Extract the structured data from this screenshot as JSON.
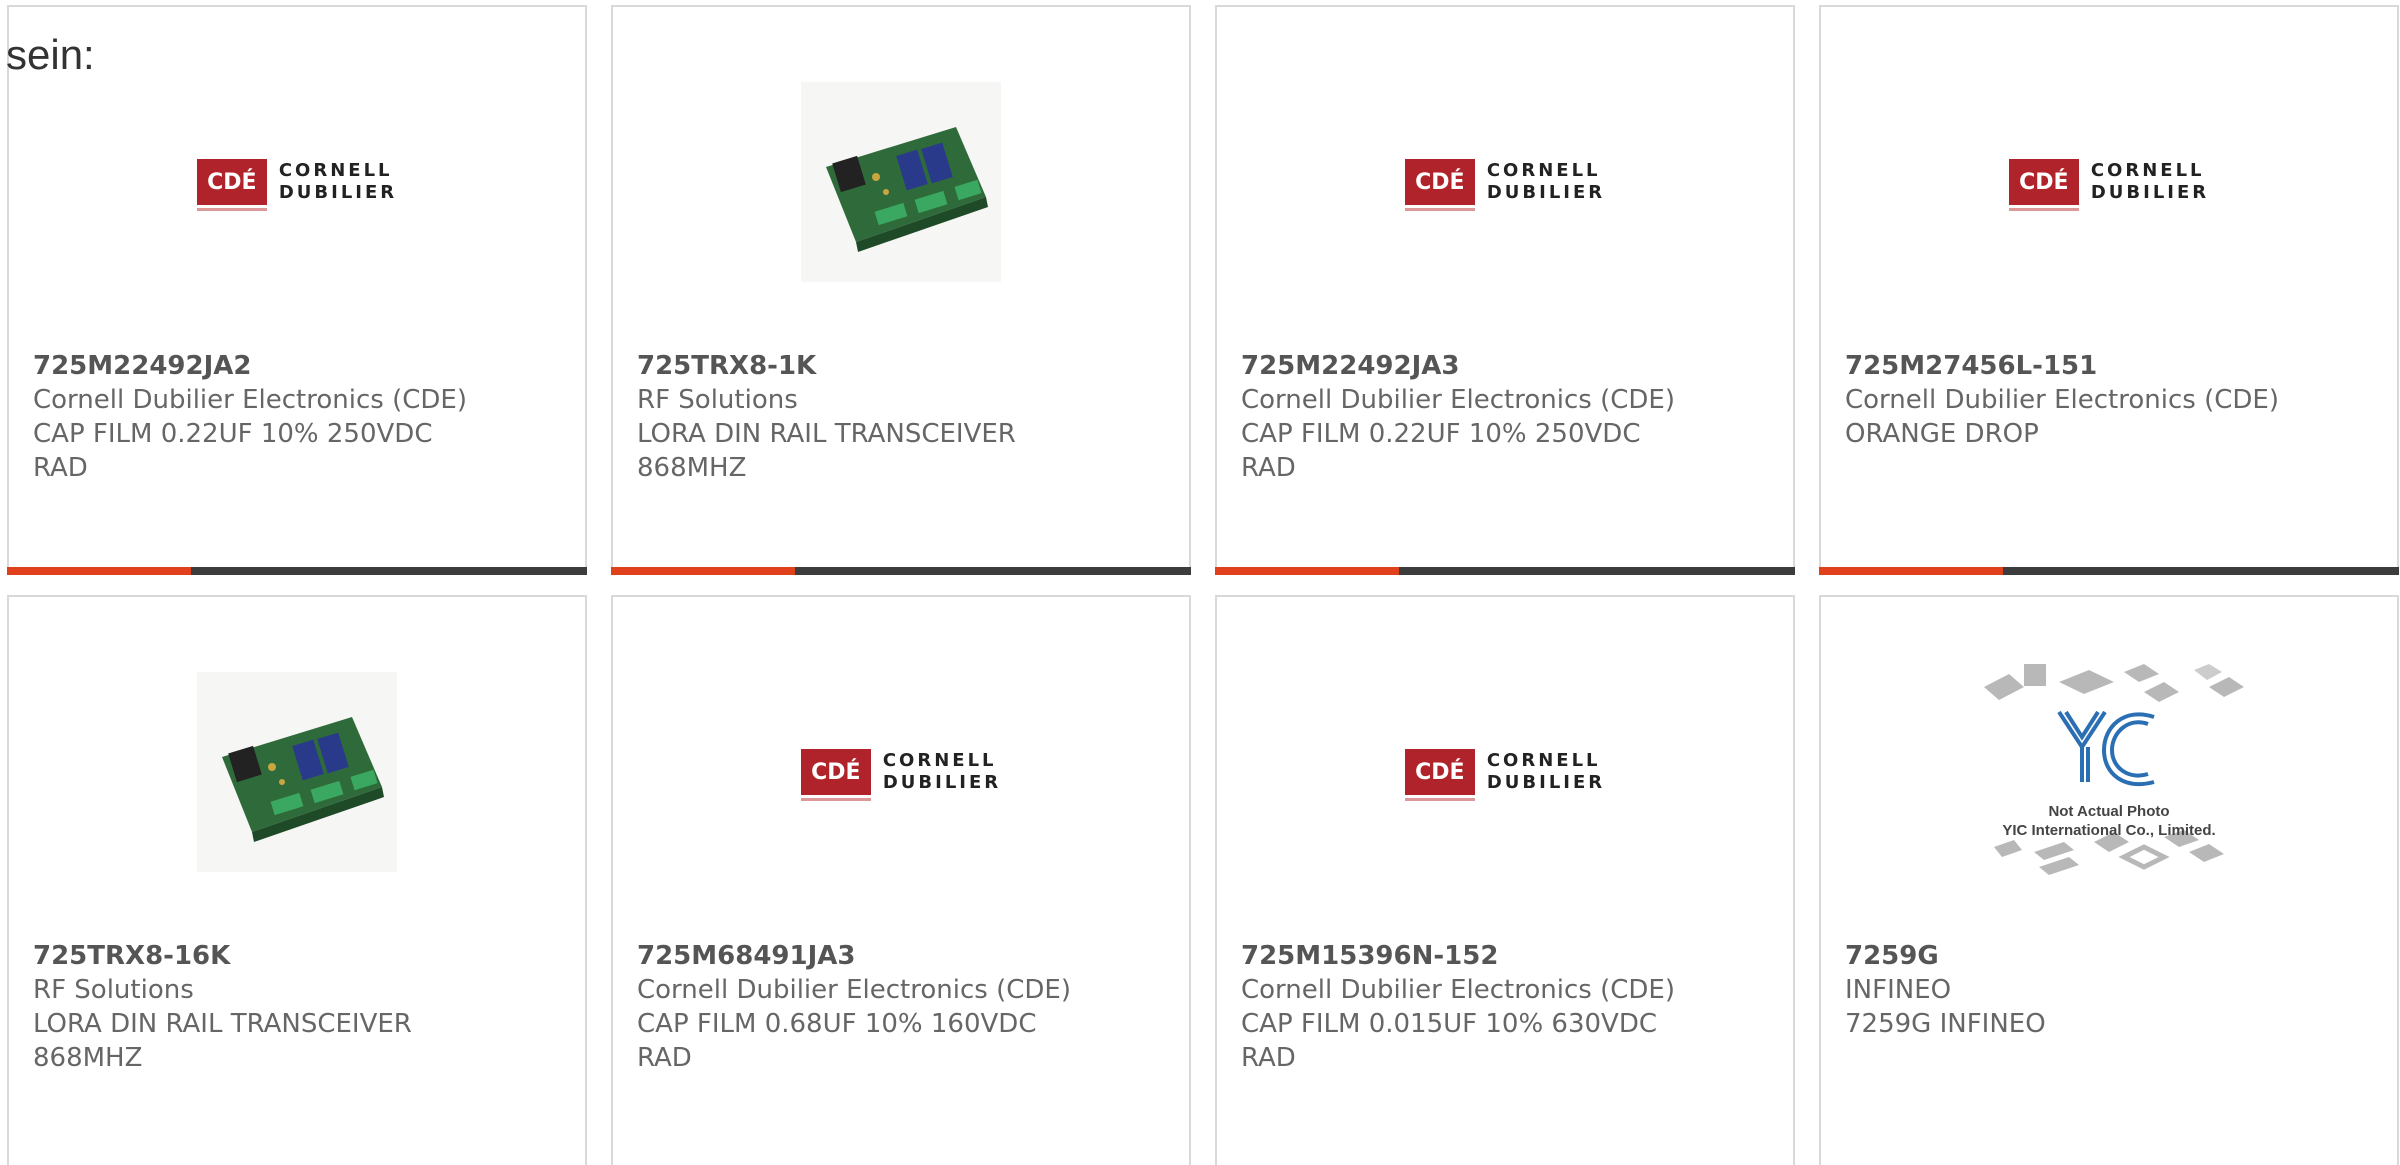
{
  "intro_text": "sein:",
  "logos": {
    "cde_mark": "CDÉ",
    "cde_line1": "CORNELL",
    "cde_line2": "DUBILIER",
    "yic_mark": "YIC",
    "yic_line1": "Not Actual Photo",
    "yic_line2": "YIC International Co., Limited."
  },
  "colors": {
    "accent": "#e0401c",
    "bar": "#3c3c3c",
    "cde_red": "#b0232a"
  },
  "products": [
    {
      "part": "725M22492JA2",
      "maker": "Cornell Dubilier Electronics (CDE)",
      "desc1": "CAP FILM 0.22UF 10% 250VDC",
      "desc2": "RAD",
      "image": "cde-logo"
    },
    {
      "part": "725TRX8-1K",
      "maker": "RF Solutions",
      "desc1": "LORA DIN RAIL TRANSCEIVER",
      "desc2": "868MHZ",
      "image": "circuit-board"
    },
    {
      "part": "725M22492JA3",
      "maker": "Cornell Dubilier Electronics (CDE)",
      "desc1": "CAP FILM 0.22UF 10% 250VDC",
      "desc2": "RAD",
      "image": "cde-logo"
    },
    {
      "part": "725M27456L-151",
      "maker": "Cornell Dubilier Electronics (CDE)",
      "desc1": "ORANGE DROP",
      "desc2": "",
      "image": "cde-logo"
    },
    {
      "part": "725TRX8-16K",
      "maker": "RF Solutions",
      "desc1": "LORA DIN RAIL TRANSCEIVER",
      "desc2": "868MHZ",
      "image": "circuit-board"
    },
    {
      "part": "725M68491JA3",
      "maker": "Cornell Dubilier Electronics (CDE)",
      "desc1": "CAP FILM 0.68UF 10% 160VDC",
      "desc2": "RAD",
      "image": "cde-logo"
    },
    {
      "part": "725M15396N-152",
      "maker": "Cornell Dubilier Electronics (CDE)",
      "desc1": "CAP FILM 0.015UF 10% 630VDC",
      "desc2": "RAD",
      "image": "cde-logo"
    },
    {
      "part": "7259G",
      "maker": "INFINEO",
      "desc1": "7259G INFINEO",
      "desc2": "",
      "image": "yic-placeholder"
    }
  ]
}
